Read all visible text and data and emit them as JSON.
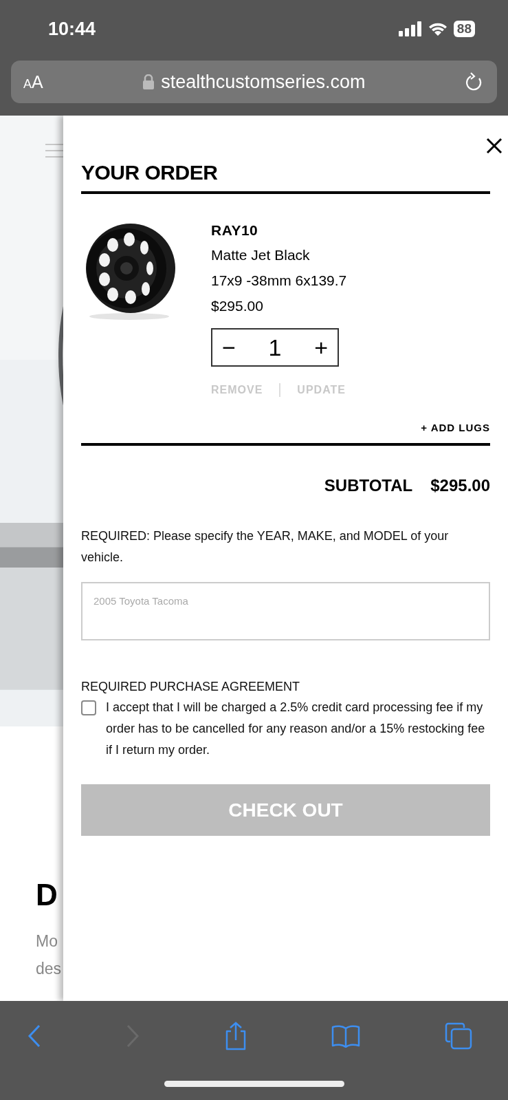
{
  "status_bar": {
    "time": "10:44",
    "battery": "88"
  },
  "browser": {
    "text_size": "AA",
    "url": "stealthcustomseries.com"
  },
  "background_page": {
    "heading": "D",
    "text_lines": [
      "Mo",
      "des"
    ]
  },
  "cart": {
    "title": "YOUR ORDER",
    "item": {
      "name": "RAY10",
      "finish": "Matte Jet Black",
      "spec": "17x9 -38mm 6x139.7",
      "price": "$295.00",
      "quantity": "1",
      "minus": "−",
      "plus": "+"
    },
    "actions": [
      "REMOVE",
      "UPDATE"
    ],
    "add_lugs": "+ ADD LUGS",
    "subtotal": {
      "label": "SUBTOTAL",
      "value": "$295.00"
    },
    "vehicle_prompt": "REQUIRED: Please specify the YEAR, MAKE, and MODEL of your vehicle.",
    "vehicle_field": {
      "placeholder": "2005 Toyota Tacoma"
    },
    "agreement": {
      "heading": "REQUIRED PURCHASE AGREEMENT",
      "checked": false,
      "text": "I accept that I will be charged a 2.5% credit card processing fee if my order has to be cancelled for any reason and/or a 15% restocking fee if I return my order."
    },
    "checkout": {
      "label": "CHECK OUT",
      "disabled": true
    }
  },
  "toolbar": {
    "forward": {
      "disabled": true
    }
  }
}
